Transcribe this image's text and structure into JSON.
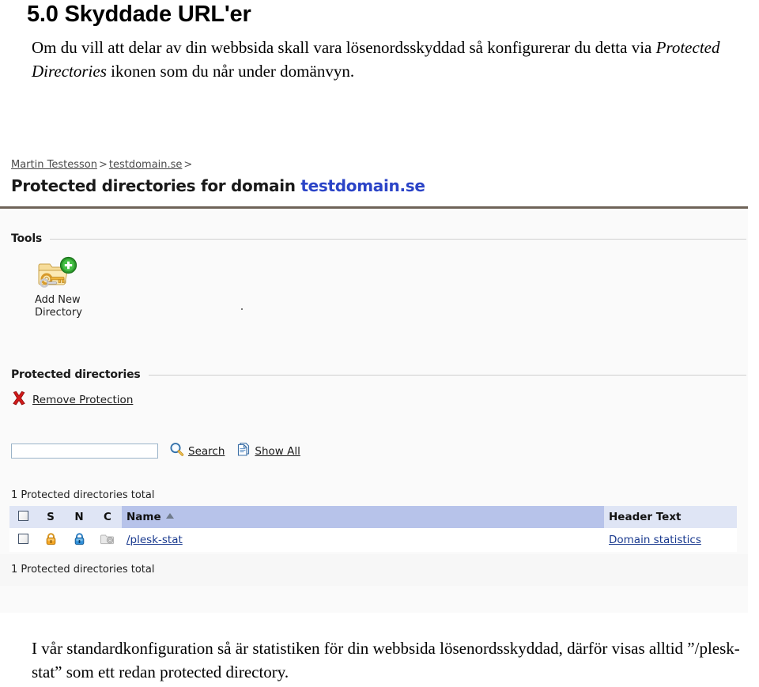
{
  "document": {
    "title": "5.0 Skyddade URL'er",
    "intro_line1": "Om du vill att delar av din webbsida skall vara lösenordsskyddad så konfigurerar du detta via",
    "intro_italic": "Protected Directories",
    "intro_line2_rest": " ikonen som du når under domänvyn.",
    "closing": "I vår standardkonfiguration så är statistiken för din webbsida lösenordsskyddad, därför visas alltid ”/plesk-stat” som ett redan protected directory."
  },
  "screenshot": {
    "breadcrumb": {
      "user": "Martin Testesson",
      "domain": "testdomain.se",
      "separator": ">"
    },
    "heading": {
      "prefix": "Protected directories for domain ",
      "domain": "testdomain.se"
    },
    "sections": {
      "tools_title": "Tools",
      "protected_title": "Protected directories"
    },
    "tools": [
      {
        "icon": "add-new-directory-icon",
        "label_line1": "Add New",
        "label_line2": "Directory"
      }
    ],
    "actions": {
      "remove_protection": "Remove Protection",
      "remove_protection_icon": "red-x-icon"
    },
    "search": {
      "value": "",
      "placeholder": "",
      "search_label": "Search",
      "search_icon": "magnifier-icon",
      "show_all_label": "Show All",
      "show_all_icon": "documents-icon"
    },
    "table": {
      "total_top": "1 Protected directories total",
      "total_bottom": "1 Protected directories total",
      "columns": [
        "",
        "S",
        "N",
        "C",
        "Name",
        "Header Text"
      ],
      "sort_column": "Name",
      "sort_direction": "asc",
      "rows": [
        {
          "checked": false,
          "s_icon": "orange-padlock-icon",
          "n_icon": "blue-padlock-icon",
          "c_icon": "disabled-settings-icon",
          "name": "/plesk-stat",
          "header_text": "Domain statistics"
        }
      ]
    },
    "colors": {
      "heading_domain": "#2b44c7",
      "header_rule": "#6e6358",
      "name_header_bg": "#b7c3ea",
      "header_bg": "#dfe5f5",
      "link": "#1a3a8f"
    }
  }
}
